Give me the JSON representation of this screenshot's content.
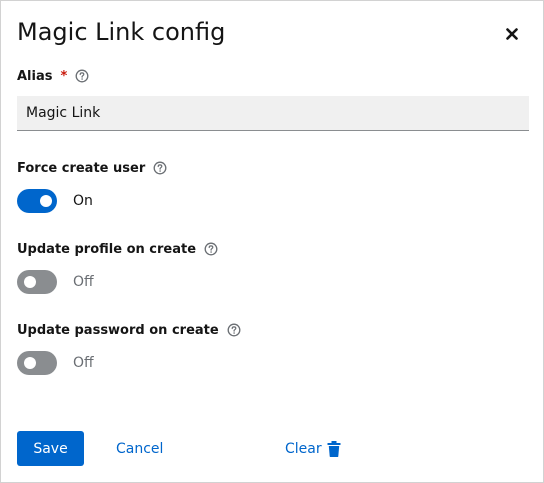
{
  "dialog": {
    "title": "Magic Link config",
    "close_icon": "close-icon"
  },
  "alias": {
    "label": "Alias",
    "required_marker": "*",
    "value": "Magic Link"
  },
  "force_create_user": {
    "label": "Force create user",
    "state": "On",
    "enabled": true
  },
  "update_profile_on_create": {
    "label": "Update profile on create",
    "state": "Off",
    "enabled": false
  },
  "update_password_on_create": {
    "label": "Update password on create",
    "state": "Off",
    "enabled": false
  },
  "actions": {
    "save_label": "Save",
    "cancel_label": "Cancel",
    "clear_label": "Clear",
    "clear_icon": "trash-icon"
  },
  "colors": {
    "primary": "#0066cc",
    "required": "#c9190b",
    "switch_off": "#8a8d90"
  }
}
